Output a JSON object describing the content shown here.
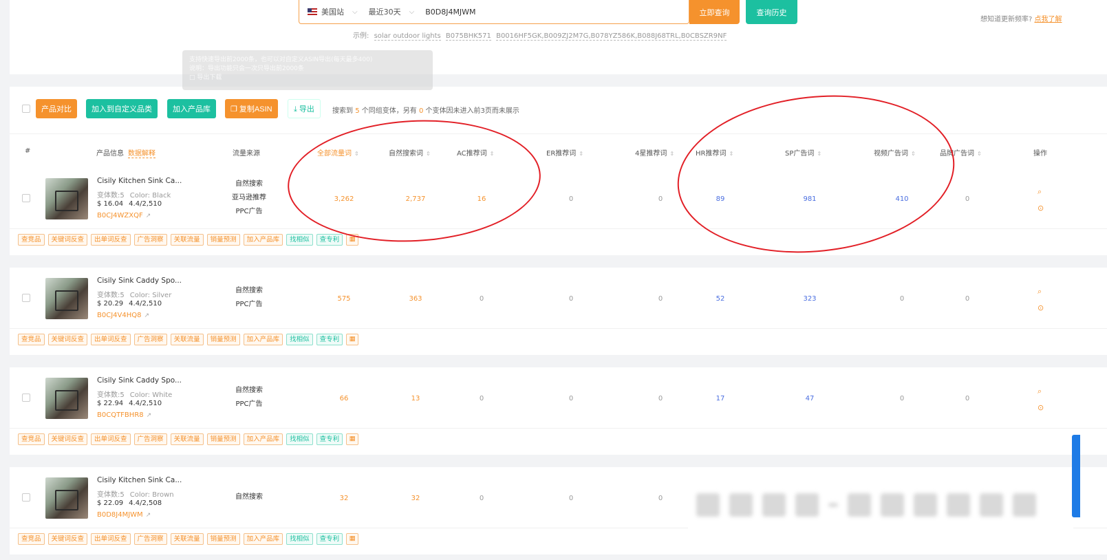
{
  "search": {
    "site": "美国站",
    "period": "最近30天",
    "query": "B0D8J4MJWM",
    "query_btn": "立即查询",
    "history_btn": "查询历史",
    "hint_text": "想知道更新频率?",
    "hint_link": "点我了解",
    "examples_label": "示例:",
    "examples": [
      "solar outdoor lights",
      "B075BHK571",
      "B0016HF5GK,B009ZJ2M7G,B078YZ586K,B088J68TRL,B0CBSZR9NF"
    ],
    "tooltip_lines": [
      "支持快速导出前2000条，也可以对自定义ASIN导出(每天最多400)",
      "说明：导出功能只会一次只导出前2000条",
      "□ 导出下载"
    ]
  },
  "toolbar": {
    "compare": "产品对比",
    "add_category": "加入到自定义品类",
    "add_library": "加入产品库",
    "copy_asin": "复制ASIN",
    "export": "导出",
    "found_prefix": "搜索到",
    "found_count": "5",
    "found_mid": "个同组变体，另有",
    "found_excluded": "0",
    "found_suffix": "个变体因未进入前3页而未展示"
  },
  "columns": {
    "index": "#",
    "product": "产品信息",
    "data_explain": "数据解释",
    "traffic_source": "流量来源",
    "all_traffic": "全部流量词",
    "organic": "自然搜索词",
    "ac": "AC推荐词",
    "er": "ER推荐词",
    "four_star": "4星推荐词",
    "hr": "HR推荐词",
    "sp": "SP广告词",
    "video": "视频广告词",
    "brand": "品牌广告词",
    "actions": "操作"
  },
  "tags": [
    "查竞品",
    "关键词反查",
    "出单词反查",
    "广告洞察",
    "关联流量",
    "销量预测",
    "加入产品库",
    "找相似",
    "查专利"
  ],
  "rows": [
    {
      "name": "Cisily Kitchen Sink Ca...",
      "variants": "变体数:5",
      "color": "Color: Black",
      "price": "$ 16.04",
      "rating": "4.4/2,510",
      "asin": "B0CJ4WZXQF",
      "sources": [
        "自然搜索",
        "亚马逊推荐",
        "PPC广告"
      ],
      "all": "3,262",
      "organic": "2,737",
      "ac": "16",
      "er": "0",
      "four": "0",
      "hr": "89",
      "sp": "981",
      "video": "410",
      "brand": "0"
    },
    {
      "name": "Cisily Sink Caddy Spo...",
      "variants": "变体数:5",
      "color": "Color: Silver",
      "price": "$ 20.29",
      "rating": "4.4/2,510",
      "asin": "B0CJ4V4HQ8",
      "sources": [
        "自然搜索",
        "PPC广告"
      ],
      "all": "575",
      "organic": "363",
      "ac": "0",
      "er": "0",
      "four": "0",
      "hr": "52",
      "sp": "323",
      "video": "0",
      "brand": "0"
    },
    {
      "name": "Cisily Sink Caddy Spo...",
      "variants": "变体数:5",
      "color": "Color: White",
      "price": "$ 22.94",
      "rating": "4.4/2,510",
      "asin": "B0CQTFBHR8",
      "sources": [
        "自然搜索",
        "PPC广告"
      ],
      "all": "66",
      "organic": "13",
      "ac": "0",
      "er": "0",
      "four": "0",
      "hr": "17",
      "sp": "47",
      "video": "0",
      "brand": "0"
    },
    {
      "name": "Cisily Kitchen Sink Ca...",
      "variants": "变体数:5",
      "color": "Color: Brown",
      "price": "$ 22.09",
      "rating": "4.4/2,508",
      "asin": "B0D8J4MJWM",
      "sources": [
        "自然搜索"
      ],
      "all": "32",
      "organic": "32",
      "ac": "0",
      "er": "0",
      "four": "0"
    }
  ],
  "colors": {
    "accent_orange": "#f5922d",
    "accent_green": "#1cc0a0",
    "value_blue": "#4a6ee0",
    "annotation_red": "#e21f26"
  }
}
